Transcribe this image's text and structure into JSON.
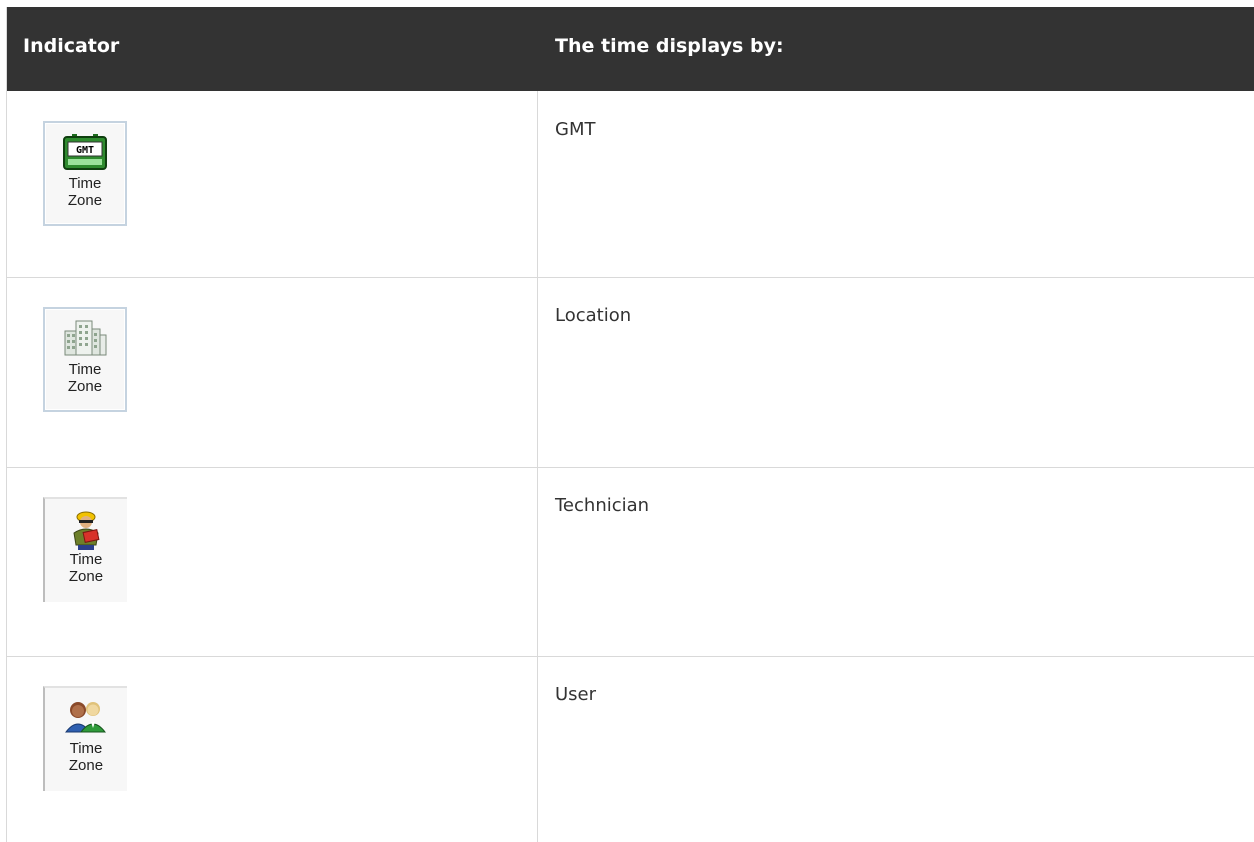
{
  "table": {
    "headers": {
      "indicator": "Indicator",
      "description": "The time displays by:"
    },
    "rows": [
      {
        "icon": "gmt-clock-icon",
        "button_label": "Time\nZone",
        "icon_text": "GMT",
        "value": "GMT"
      },
      {
        "icon": "building-icon",
        "button_label": "Time\nZone",
        "value": "Location"
      },
      {
        "icon": "technician-icon",
        "button_label": "Time\nZone",
        "value": "Technician"
      },
      {
        "icon": "users-icon",
        "button_label": "Time\nZone",
        "value": "User"
      }
    ]
  },
  "colors": {
    "header_bg": "#333333",
    "header_text": "#ffffff",
    "grid": "#d9d9d9"
  }
}
